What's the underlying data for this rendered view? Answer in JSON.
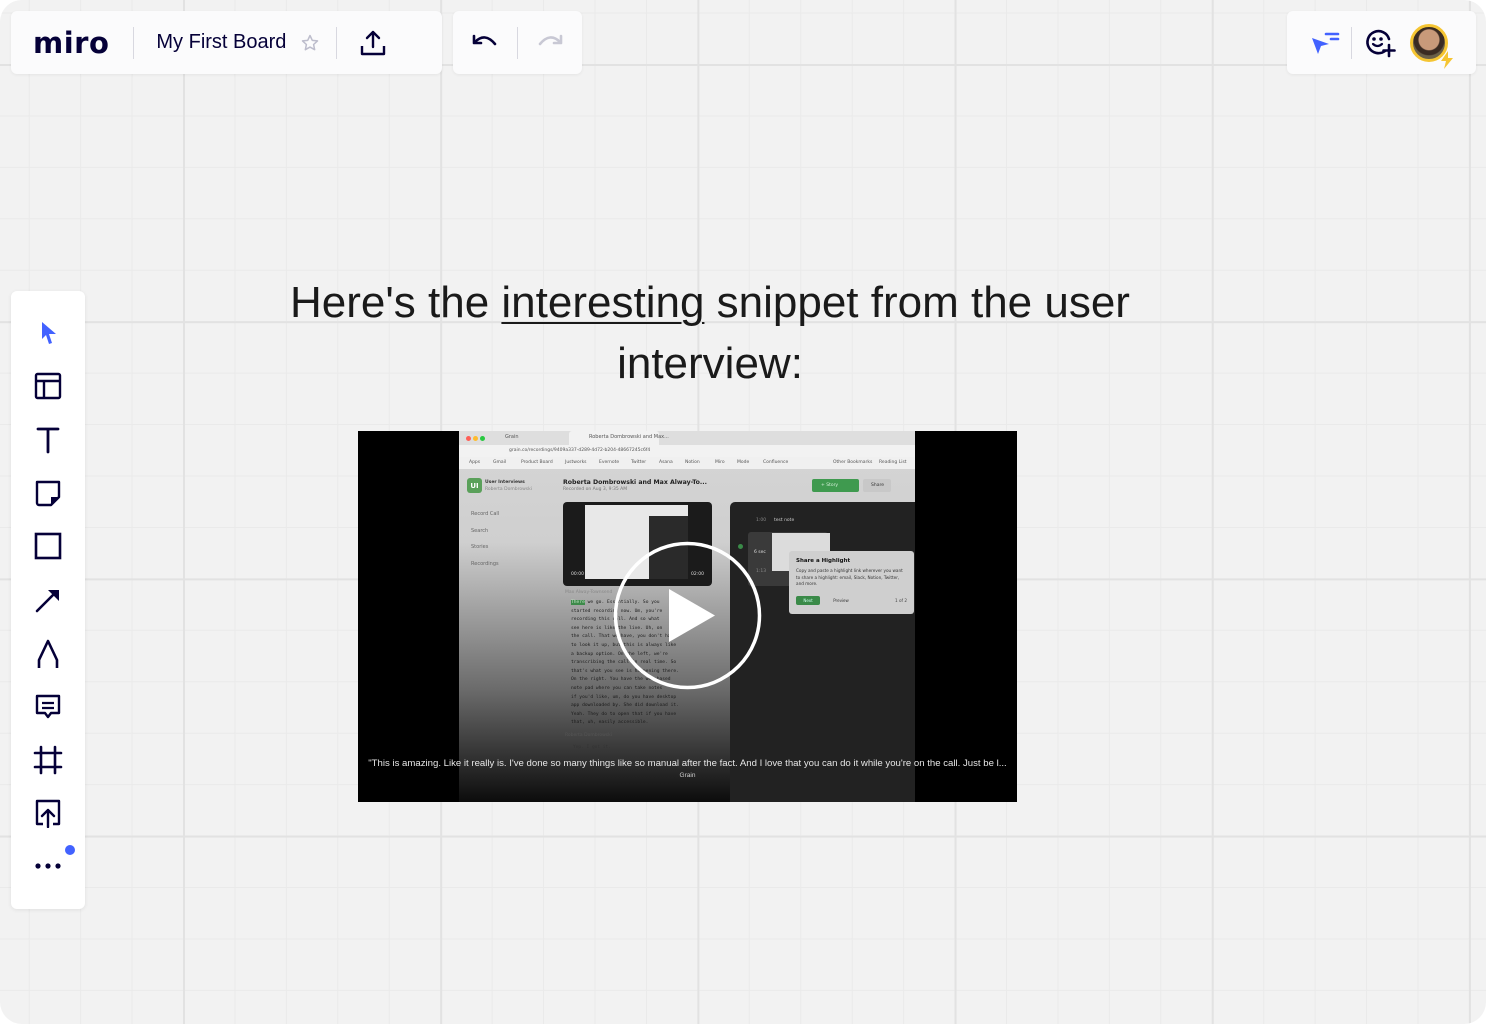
{
  "app": {
    "logo_text": "miro",
    "board_title": "My First Board"
  },
  "top_bar": {
    "star_icon": "star-icon",
    "share_icon": "upload-icon",
    "undo_icon": "undo-icon",
    "redo_icon": "redo-icon"
  },
  "user_bar": {
    "icons": [
      "cursor-filter-icon",
      "add-reaction-icon"
    ],
    "avatar_alt": "User avatar"
  },
  "toolbar": {
    "tools": [
      {
        "name": "select",
        "icon": "cursor-icon",
        "active": true
      },
      {
        "name": "templates",
        "icon": "template-icon"
      },
      {
        "name": "text",
        "icon": "text-icon"
      },
      {
        "name": "sticky-note",
        "icon": "sticky-note-icon"
      },
      {
        "name": "shape",
        "icon": "rectangle-icon"
      },
      {
        "name": "connection-line",
        "icon": "arrow-icon"
      },
      {
        "name": "pen",
        "icon": "pen-icon"
      },
      {
        "name": "comment",
        "icon": "comment-icon"
      },
      {
        "name": "frame",
        "icon": "frame-icon"
      },
      {
        "name": "upload",
        "icon": "upload-box-icon"
      },
      {
        "name": "more",
        "icon": "more-icon",
        "has_notification": true
      }
    ],
    "accent_color": "#4262ff"
  },
  "canvas": {
    "heading_before": "Here's the ",
    "heading_underlined": "interesting",
    "heading_after": " snippet from the user interview:"
  },
  "video": {
    "caption": "\"This is amazing. Like it really is. I've done so many things like so manual after the fact. And I love that you can do it while you're on the call. Just be l...",
    "source": "Grain",
    "frame": {
      "tabs": [
        "Grain",
        "Roberta Dombrowski and Max..."
      ],
      "url": "grain.co/recordings/9409a337-d289-4d72-b204-48667245c6f4",
      "bookmarks": [
        "Apps",
        "Gmail",
        "Product Board",
        "Justworks",
        "Evernote",
        "Twitter",
        "Asana",
        "Notion",
        "Miro",
        "Mode",
        "Confluence",
        "Other Bookmarks",
        "Reading List"
      ],
      "workspace_name": "User Interviews",
      "workspace_owner": "Roberta Dombrowski",
      "recording_title": "Roberta Dombrowski and Max Alway-To...",
      "recorded_on": "Recorded on Aug 3, 9:35 AM",
      "story_button": "+ Story",
      "share_button": "Share",
      "sidebar": [
        "Record Call",
        "Search",
        "Stories",
        "Recordings"
      ],
      "player_time_start": "00:00",
      "player_time_end": "02:00",
      "speaker": "Max Alway-Townsend",
      "transcript_highlight": "There",
      "transcript": " we go. Essentially. So you\nstarted recording now. Um, you're\nrecording this call. And so what\nsee here is like the live. Uh, on\nthe call. That we have, you don't have\nto look it up, but this is always like\na backup option. On the left, we're\ntranscribing the call in real time. So\nthat's what you see is happening there.\nOn the right. You have the web-based\nnote pad where you can take notes\nif you'd like, um, do you have desktop\napp downloaded by. She did download it.\nYeah. They do to open that if you have\nthat, uh, easily accessible.",
      "speaker2": "Roberta Dombrowski",
      "transcript2": "Yep. I got it.",
      "note_time": "1:00",
      "note_text": "test note",
      "clip_duration": "6 sec",
      "clip_time": "1:13",
      "popup_title": "Share a Highlight",
      "popup_body": "Copy and paste a highlight link wherever you want to share a highlight: email, Slack, Notion, Twitter, and more.",
      "popup_next": "Next",
      "popup_preview": "Preview",
      "popup_count": "1 of 2"
    }
  }
}
